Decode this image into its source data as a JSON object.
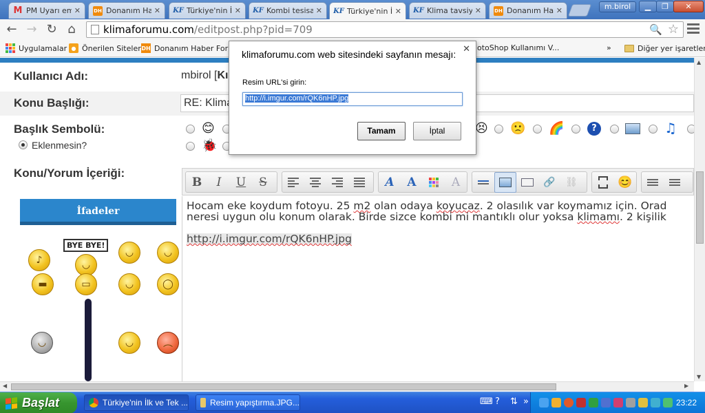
{
  "browser": {
    "tabs": [
      {
        "label": "PM Uyarı em",
        "icon": "pm"
      },
      {
        "label": "Donanım Hab",
        "icon": "dh"
      },
      {
        "label": "Türkiye'nin İl",
        "icon": "kf"
      },
      {
        "label": "Kombi tesisat",
        "icon": "kf"
      },
      {
        "label": "Türkiye'nin İl",
        "icon": "kf",
        "active": true
      },
      {
        "label": "Klima tavsiye",
        "icon": "kf"
      },
      {
        "label": "Donanım Hab",
        "icon": "dh"
      }
    ],
    "user": "m.birol",
    "url_host": "klimaforumu.com",
    "url_path": "/editpost.php?pid=709",
    "bookmarks": {
      "apps": "Uygulamalar",
      "suggested": "Önerilen Siteler",
      "dh_forum": "Donanım Haber Forum",
      "photoshop": "otoShop Kullanımı V...",
      "more": "»",
      "other": "Diğer yer işaretleri"
    }
  },
  "form": {
    "username_label": "Kullanıcı Adı:",
    "username_value": "mbirol [",
    "username_value_bold": "Kı",
    "subject_label": "Konu Başlığı:",
    "subject_value": "RE: Klima",
    "symbol_label": "Başlık Sembolü:",
    "no_symbol_label": "Eklenmesin?",
    "content_label": "Konu/Yorum İçeriği:"
  },
  "smilies": {
    "title": "İfadeler",
    "bye_sign": "BYE BYE!"
  },
  "editor": {
    "line1_a": "Hocam eke koydum fotoyu. 25 ",
    "line1_m2": "m2",
    "line1_b": " olan odaya ",
    "line1_koyucaz": "koyucaz",
    "line1_c": ". 2 olasılık var koymamız için. Orad",
    "line2_a": "neresi uygun olu konum olarak. Birde sizce kombi mi mantıklı olur yoksa ",
    "line2_klimami": "klimamı",
    "line2_b": ". 2 kişilik",
    "url": "http://i.imgur.com/rQK6nHP.jpg"
  },
  "dialog": {
    "title": "klimaforumu.com web sitesindeki sayfanın mesajı:",
    "prompt": "Resim URL'si girin:",
    "input_value": "http://i.imgur.com/rQK6nHP.jpg",
    "ok": "Tamam",
    "cancel": "İptal"
  },
  "taskbar": {
    "start": "Başlat",
    "tasks": [
      {
        "label": "Türkiye'nin İlk ve Tek ...",
        "active": true
      },
      {
        "label": "Resim yapıştırma.JPG..."
      }
    ],
    "clock": "23:22"
  },
  "colors": {
    "accent": "#2b86cc",
    "xp_taskbar": "#245edb",
    "start_green": "#37952f"
  }
}
